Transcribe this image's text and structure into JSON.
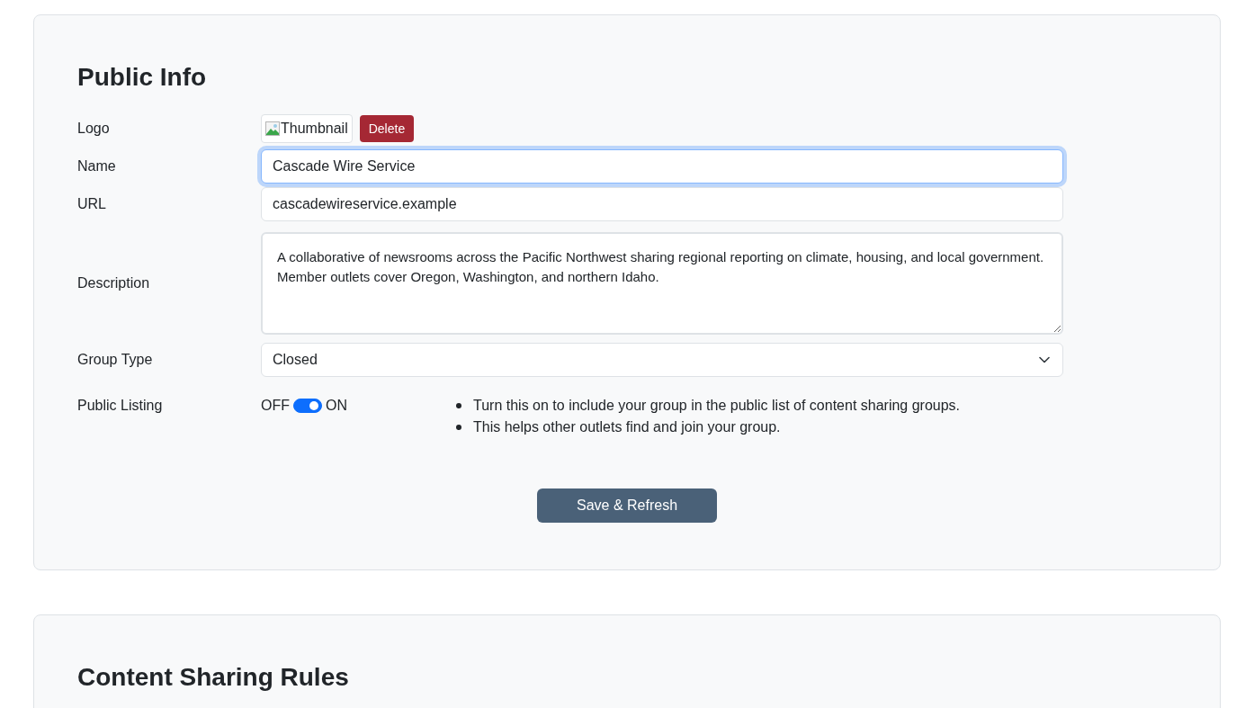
{
  "public_info": {
    "title": "Public Info",
    "logo": {
      "label": "Logo",
      "image_alt": "Thumbnail",
      "delete_button": "Delete"
    },
    "name": {
      "label": "Name",
      "value": "Cascade Wire Service",
      "focused": true
    },
    "url": {
      "label": "URL",
      "value": "cascadewireservice.example",
      "focused": false
    },
    "description": {
      "label": "Description",
      "value": "A collaborative of newsrooms across the Pacific Northwest sharing regional reporting on climate, housing, and local government. Member outlets cover Oregon, Washington, and northern Idaho."
    },
    "group_type": {
      "label": "Group Type",
      "value": "Closed"
    },
    "public_listing": {
      "label": "Public Listing",
      "off_label": "OFF",
      "on_label": "ON",
      "on": true,
      "notes": [
        "Turn this on to include your group in the public list of content sharing groups.",
        "This helps other outlets find and join your group."
      ]
    },
    "save_button": "Save & Refresh"
  },
  "content_sharing_rules": {
    "title": "Content Sharing Rules"
  }
}
